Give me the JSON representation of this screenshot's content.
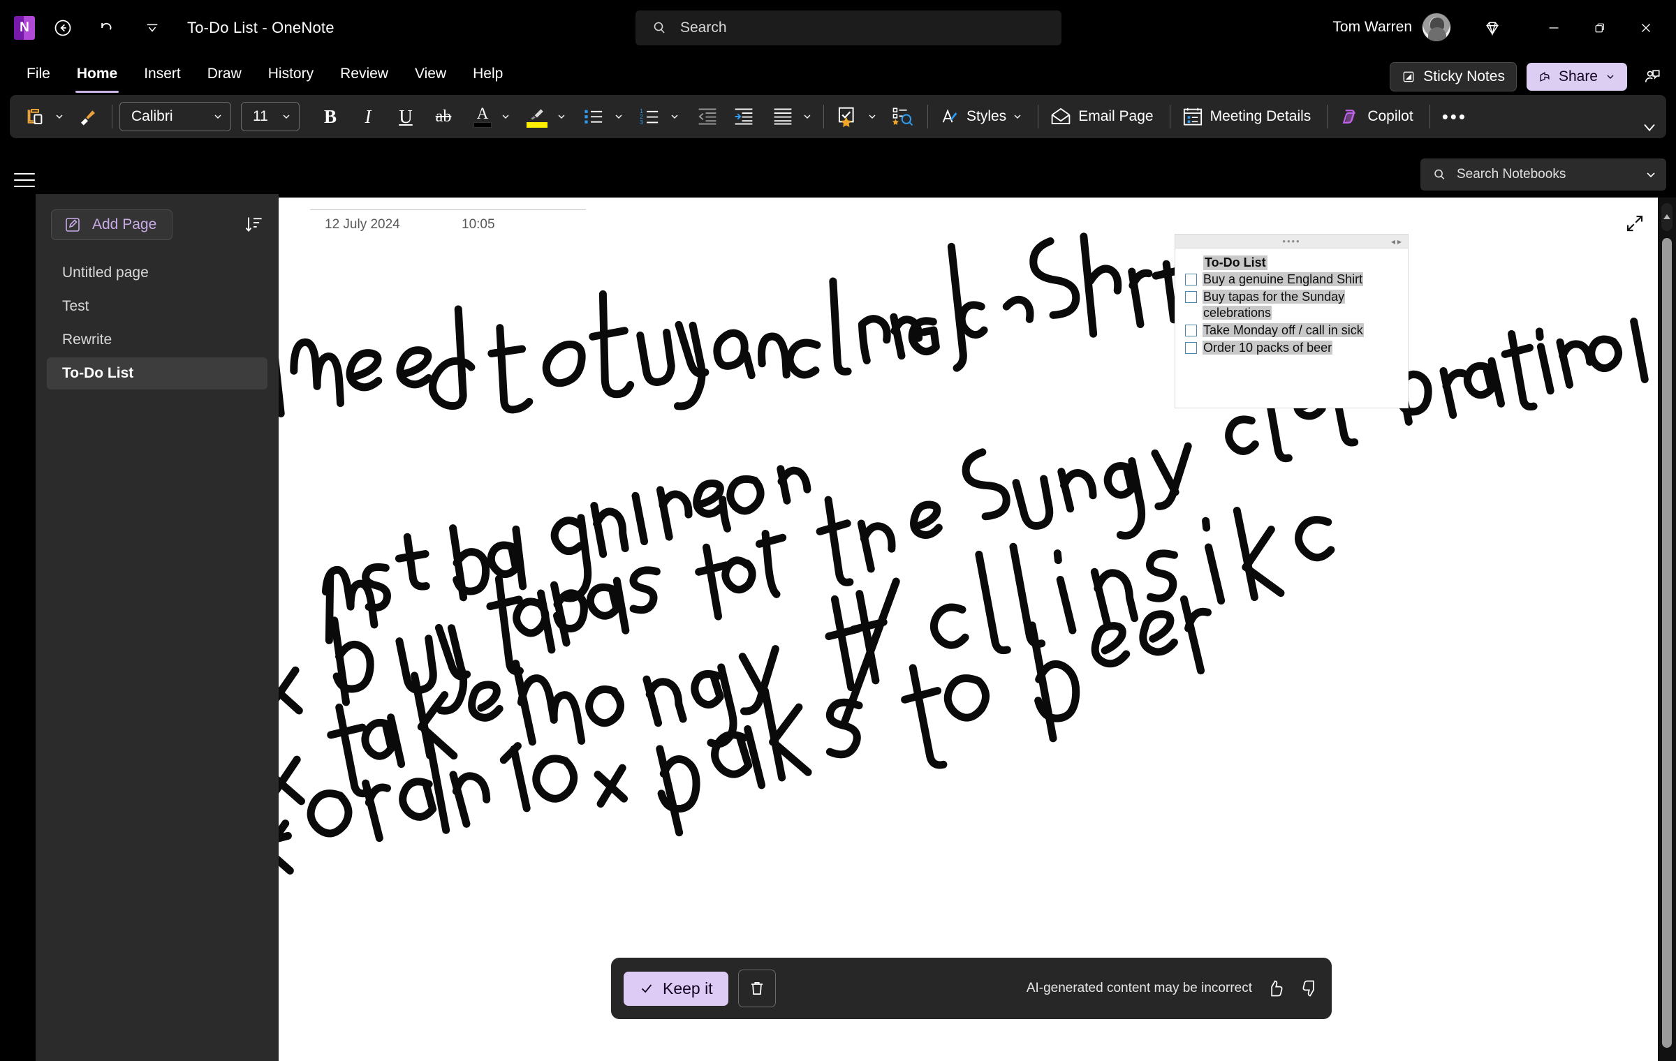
{
  "titlebar": {
    "app_logo_letter": "N",
    "title": "To-Do List  -  OneNote",
    "back_icon": "back-circle-icon",
    "undo_icon": "undo-icon",
    "customize_icon": "customize-quick-access-icon",
    "account_name": "Tom Warren",
    "diamond_icon": "diamond-icon",
    "minimize_label": "—",
    "restore_label": "❐",
    "close_label": "✕"
  },
  "search": {
    "placeholder": "Search",
    "icon": "search-icon"
  },
  "menubar": {
    "items": [
      {
        "label": "File",
        "active": false
      },
      {
        "label": "Home",
        "active": true
      },
      {
        "label": "Insert",
        "active": false
      },
      {
        "label": "Draw",
        "active": false
      },
      {
        "label": "History",
        "active": false
      },
      {
        "label": "Review",
        "active": false
      },
      {
        "label": "View",
        "active": false
      },
      {
        "label": "Help",
        "active": false
      }
    ],
    "sticky_notes_label": "Sticky Notes",
    "share_label": "Share",
    "people_icon": "person-chat-icon"
  },
  "ribbon": {
    "paste_icon": "paste-icon",
    "format_painter_icon": "format-painter-icon",
    "font_name": "Calibri",
    "font_size": "11",
    "bold_label": "B",
    "italic_label": "I",
    "underline_label": "U",
    "strikethrough_label": "ab",
    "font_color_label": "A",
    "highlight_icon": "highlighter-icon",
    "bullets_icon": "bullet-list-icon",
    "numbering_icon": "numbered-list-icon",
    "decrease_indent_icon": "decrease-indent-icon",
    "increase_indent_icon": "increase-indent-icon",
    "align_icon": "align-icon",
    "tags_icon": "tag-star-icon",
    "find_tags_icon": "find-tags-icon",
    "styles_label": "Styles",
    "styles_icon": "styles-icon",
    "email_page_label": "Email Page",
    "email_icon": "envelope-icon",
    "meeting_details_label": "Meeting Details",
    "meeting_icon": "calendar-details-icon",
    "copilot_label": "Copilot",
    "copilot_icon": "copilot-icon",
    "more_label": "•••",
    "collapse_icon": "chevron-down-icon"
  },
  "notebook_search": {
    "placeholder": "Search Notebooks",
    "icon": "search-icon",
    "chevron": "chevron-down-icon"
  },
  "sidebar": {
    "hamburger_icon": "hamburger-menu-icon",
    "add_page_label": "Add Page",
    "add_page_icon": "add-page-icon",
    "sort_icon": "sort-icon",
    "pages": [
      {
        "label": "Untitled page",
        "selected": false
      },
      {
        "label": "Test",
        "selected": false
      },
      {
        "label": "Rewrite",
        "selected": false
      },
      {
        "label": "To-Do List",
        "selected": true
      }
    ]
  },
  "canvas": {
    "date": "12 July 2024",
    "time": "10:05",
    "expand_icon": "expand-diagonal-icon",
    "ink_text_lines": [
      "x I need to buy an England Shirt, it",
      "must be a genuine one",
      "x buy tapas for the Sunday celebrations",
      "x take Monday off / call in sick",
      "x order 10x packs of beer"
    ]
  },
  "note_box": {
    "grip_icon": "drag-grip-icon",
    "resize_arrows": "◂▸",
    "title": "To-Do List",
    "items": [
      "Buy a genuine England Shirt",
      "Buy tapas for the Sunday celebrations",
      "Take Monday off / call in sick",
      "Order 10 packs of beer"
    ]
  },
  "toast": {
    "keep_label": "Keep it",
    "keep_icon": "check-icon",
    "delete_icon": "trash-icon",
    "disclaimer": "AI-generated content may be incorrect",
    "thumbs_up_icon": "thumbs-up-icon",
    "thumbs_down_icon": "thumbs-down-icon"
  },
  "colors": {
    "accent_purple": "#c9abe8",
    "share_bg": "#dccdf2",
    "keep_bg": "#ddcbf5",
    "canvas_bg": "#ffffff",
    "chrome_bg": "#000000",
    "ribbon_bg": "#262626",
    "sidebar_bg": "#2b2b2b",
    "highlight_gray": "#c9c9c9",
    "checkbox_border": "#4f88a8"
  }
}
